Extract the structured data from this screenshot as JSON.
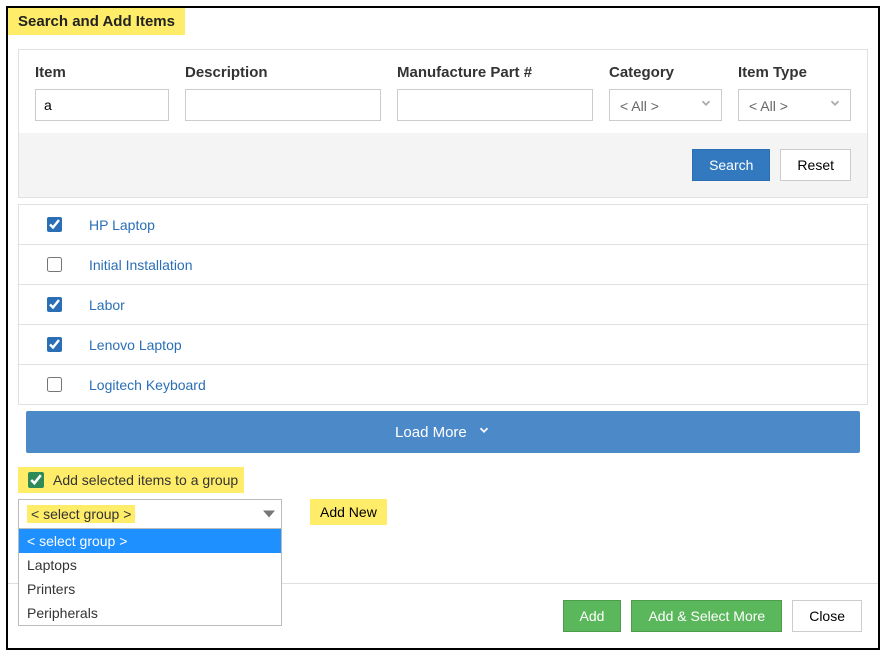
{
  "header": {
    "title": "Search and Add Items"
  },
  "filters": {
    "item": {
      "label": "Item",
      "value": "a",
      "placeholder": ""
    },
    "description": {
      "label": "Description",
      "value": "",
      "placeholder": ""
    },
    "mpn": {
      "label": "Manufacture Part #",
      "value": "",
      "placeholder": ""
    },
    "category": {
      "label": "Category",
      "value": "< All >"
    },
    "itemtype": {
      "label": "Item Type",
      "value": "< All >"
    }
  },
  "filter_buttons": {
    "search": "Search",
    "reset": "Reset"
  },
  "results": [
    {
      "name": "HP Laptop",
      "checked": true
    },
    {
      "name": "Initial Installation",
      "checked": false
    },
    {
      "name": "Labor",
      "checked": true
    },
    {
      "name": "Lenovo Laptop",
      "checked": true
    },
    {
      "name": "Logitech Keyboard",
      "checked": false
    }
  ],
  "load_more_label": "Load More",
  "group": {
    "checkbox_label": "Add selected items to a group",
    "checked": true,
    "selected": "< select group >",
    "options": [
      "< select group >",
      "Laptops",
      "Printers",
      "Peripherals"
    ],
    "add_new_label": "Add New"
  },
  "footer_buttons": {
    "add": "Add",
    "add_more": "Add & Select More",
    "close": "Close"
  }
}
